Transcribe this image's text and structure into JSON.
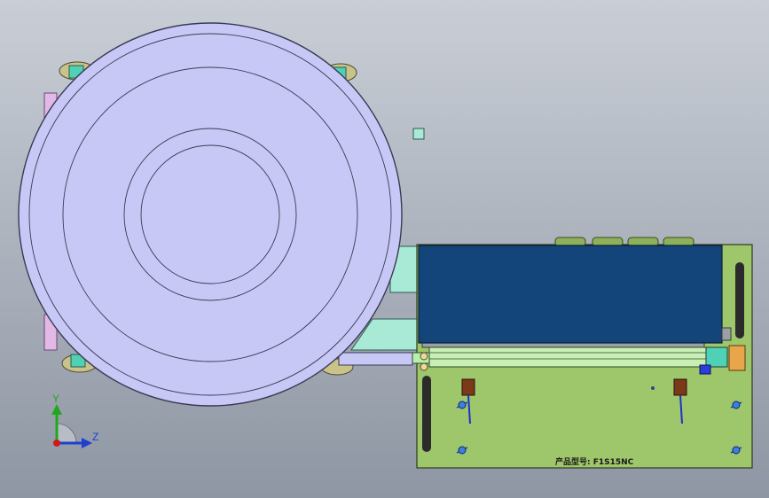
{
  "viewport": {
    "background_top": "#c9ced6",
    "background_bottom": "#8e96a3"
  },
  "bowl": {
    "fill": "#c8c8f6",
    "stroke": "#3a3a55"
  },
  "plate": {
    "fill": "#9ec66a",
    "label": "产品型号: F1S15NC"
  },
  "hopper": {
    "fill": "#13457a"
  },
  "feeder_rail": {
    "fill": "#c9efb4"
  },
  "triad": {
    "y_label": "Y",
    "z_label": "Z",
    "y_color": "#1fa81f",
    "z_color": "#1f3fd1",
    "origin_color": "#d01818"
  }
}
